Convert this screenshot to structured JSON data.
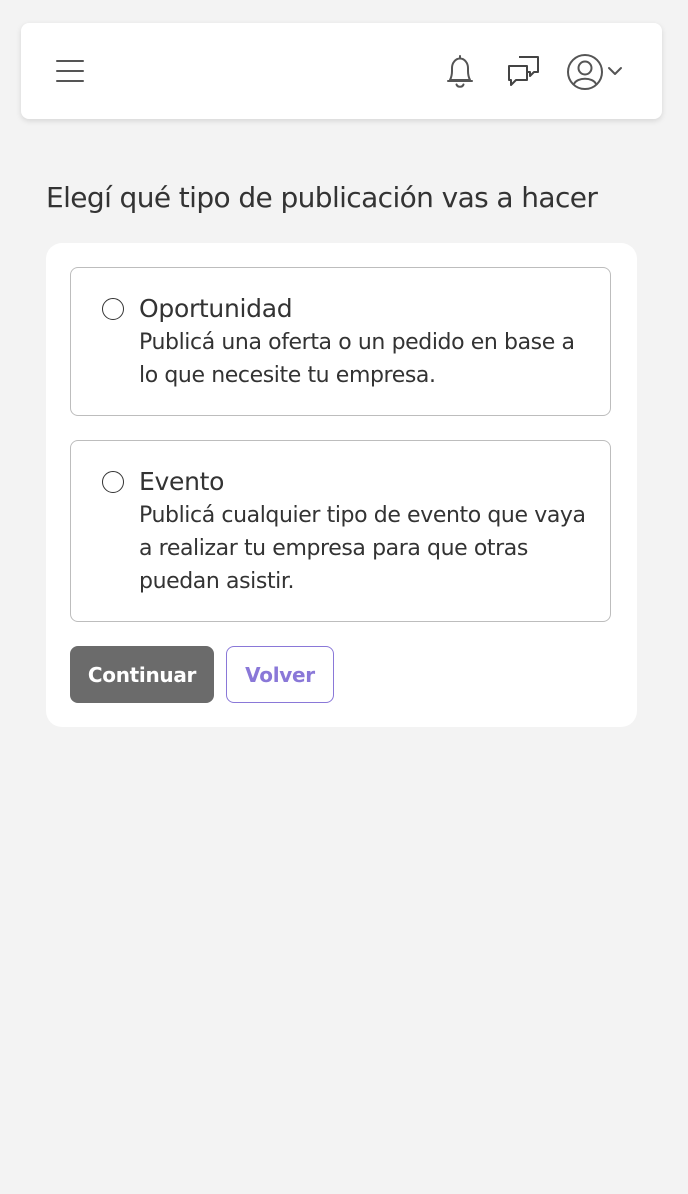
{
  "header": {
    "icons": {
      "menu": "menu-icon",
      "notifications": "bell-icon",
      "messages": "chat-icon",
      "profile": "avatar-icon",
      "profile_menu": "chevron-down-icon"
    }
  },
  "main": {
    "title": "Elegí qué tipo de publicación vas a hacer",
    "options": [
      {
        "title": "Oportunidad",
        "description": "Publicá una oferta o un pedido en base a lo que necesite tu empresa.",
        "selected": false
      },
      {
        "title": "Evento",
        "description": "Publicá cualquier tipo de evento que vaya a realizar tu empresa para que otras puedan asistir.",
        "selected": false
      }
    ],
    "buttons": {
      "continue": "Continuar",
      "back": "Volver"
    }
  },
  "colors": {
    "background": "#f3f3f3",
    "primary_button": "#6b6b6b",
    "accent": "#8a78d8",
    "text": "#333333"
  }
}
